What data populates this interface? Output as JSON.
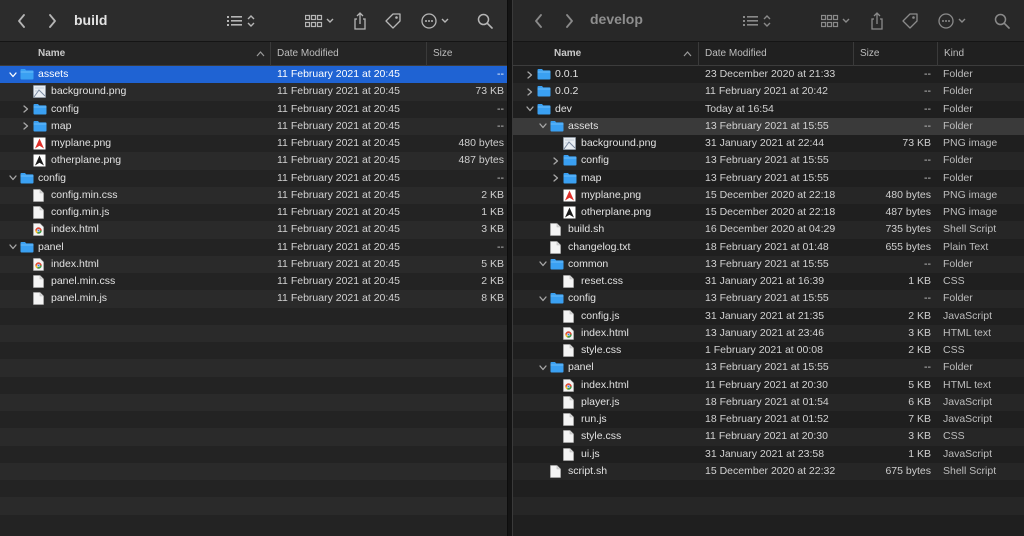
{
  "left": {
    "title": "build",
    "columns": {
      "name": "Name",
      "date": "Date Modified",
      "size": "Size"
    },
    "rows": [
      {
        "depth": 0,
        "disc": "open",
        "icon": "folder",
        "name": "assets",
        "date": "11 February 2021 at 20:45",
        "size": "--",
        "selected": true
      },
      {
        "depth": 1,
        "disc": "",
        "icon": "image",
        "name": "background.png",
        "date": "11 February 2021 at 20:45",
        "size": "73 KB"
      },
      {
        "depth": 1,
        "disc": "closed",
        "icon": "folder",
        "name": "config",
        "date": "11 February 2021 at 20:45",
        "size": "--"
      },
      {
        "depth": 1,
        "disc": "closed",
        "icon": "folder",
        "name": "map",
        "date": "11 February 2021 at 20:45",
        "size": "--"
      },
      {
        "depth": 1,
        "disc": "",
        "icon": "plane-red",
        "name": "myplane.png",
        "date": "11 February 2021 at 20:45",
        "size": "480 bytes"
      },
      {
        "depth": 1,
        "disc": "",
        "icon": "plane-dark",
        "name": "otherplane.png",
        "date": "11 February 2021 at 20:45",
        "size": "487 bytes"
      },
      {
        "depth": 0,
        "disc": "open",
        "icon": "folder",
        "name": "config",
        "date": "11 February 2021 at 20:45",
        "size": "--"
      },
      {
        "depth": 1,
        "disc": "",
        "icon": "doc",
        "name": "config.min.css",
        "date": "11 February 2021 at 20:45",
        "size": "2 KB"
      },
      {
        "depth": 1,
        "disc": "",
        "icon": "doc",
        "name": "config.min.js",
        "date": "11 February 2021 at 20:45",
        "size": "1 KB"
      },
      {
        "depth": 1,
        "disc": "",
        "icon": "html",
        "name": "index.html",
        "date": "11 February 2021 at 20:45",
        "size": "3 KB"
      },
      {
        "depth": 0,
        "disc": "open",
        "icon": "folder",
        "name": "panel",
        "date": "11 February 2021 at 20:45",
        "size": "--"
      },
      {
        "depth": 1,
        "disc": "",
        "icon": "html",
        "name": "index.html",
        "date": "11 February 2021 at 20:45",
        "size": "5 KB"
      },
      {
        "depth": 1,
        "disc": "",
        "icon": "doc",
        "name": "panel.min.css",
        "date": "11 February 2021 at 20:45",
        "size": "2 KB"
      },
      {
        "depth": 1,
        "disc": "",
        "icon": "doc",
        "name": "panel.min.js",
        "date": "11 February 2021 at 20:45",
        "size": "8 KB"
      }
    ],
    "empty_rows": 13
  },
  "right": {
    "title": "develop",
    "columns": {
      "name": "Name",
      "date": "Date Modified",
      "size": "Size",
      "kind": "Kind"
    },
    "rows": [
      {
        "depth": 0,
        "disc": "closed",
        "icon": "folder",
        "name": "0.0.1",
        "date": "23 December 2020 at 21:33",
        "size": "--",
        "kind": "Folder"
      },
      {
        "depth": 0,
        "disc": "closed",
        "icon": "folder",
        "name": "0.0.2",
        "date": "11 February 2021 at 20:42",
        "size": "--",
        "kind": "Folder"
      },
      {
        "depth": 0,
        "disc": "open",
        "icon": "folder",
        "name": "dev",
        "date": "Today at 16:54",
        "size": "--",
        "kind": "Folder"
      },
      {
        "depth": 1,
        "disc": "open",
        "icon": "folder",
        "name": "assets",
        "date": "13 February 2021 at 15:55",
        "size": "--",
        "kind": "Folder",
        "focus": true
      },
      {
        "depth": 2,
        "disc": "",
        "icon": "image",
        "name": "background.png",
        "date": "31 January 2021 at 22:44",
        "size": "73 KB",
        "kind": "PNG image"
      },
      {
        "depth": 2,
        "disc": "closed",
        "icon": "folder",
        "name": "config",
        "date": "13 February 2021 at 15:55",
        "size": "--",
        "kind": "Folder"
      },
      {
        "depth": 2,
        "disc": "closed",
        "icon": "folder",
        "name": "map",
        "date": "13 February 2021 at 15:55",
        "size": "--",
        "kind": "Folder"
      },
      {
        "depth": 2,
        "disc": "",
        "icon": "plane-red",
        "name": "myplane.png",
        "date": "15 December 2020 at 22:18",
        "size": "480 bytes",
        "kind": "PNG image"
      },
      {
        "depth": 2,
        "disc": "",
        "icon": "plane-dark",
        "name": "otherplane.png",
        "date": "15 December 2020 at 22:18",
        "size": "487 bytes",
        "kind": "PNG image"
      },
      {
        "depth": 1,
        "disc": "",
        "icon": "doc",
        "name": "build.sh",
        "date": "16 December 2020 at 04:29",
        "size": "735 bytes",
        "kind": "Shell Script"
      },
      {
        "depth": 1,
        "disc": "",
        "icon": "doc",
        "name": "changelog.txt",
        "date": "18 February 2021 at 01:48",
        "size": "655 bytes",
        "kind": "Plain Text"
      },
      {
        "depth": 1,
        "disc": "open",
        "icon": "folder",
        "name": "common",
        "date": "13 February 2021 at 15:55",
        "size": "--",
        "kind": "Folder"
      },
      {
        "depth": 2,
        "disc": "",
        "icon": "doc",
        "name": "reset.css",
        "date": "31 January 2021 at 16:39",
        "size": "1 KB",
        "kind": "CSS"
      },
      {
        "depth": 1,
        "disc": "open",
        "icon": "folder",
        "name": "config",
        "date": "13 February 2021 at 15:55",
        "size": "--",
        "kind": "Folder"
      },
      {
        "depth": 2,
        "disc": "",
        "icon": "doc",
        "name": "config.js",
        "date": "31 January 2021 at 21:35",
        "size": "2 KB",
        "kind": "JavaScript"
      },
      {
        "depth": 2,
        "disc": "",
        "icon": "html",
        "name": "index.html",
        "date": "13 January 2021 at 23:46",
        "size": "3 KB",
        "kind": "HTML text"
      },
      {
        "depth": 2,
        "disc": "",
        "icon": "doc",
        "name": "style.css",
        "date": "1 February 2021 at 00:08",
        "size": "2 KB",
        "kind": "CSS"
      },
      {
        "depth": 1,
        "disc": "open",
        "icon": "folder",
        "name": "panel",
        "date": "13 February 2021 at 15:55",
        "size": "--",
        "kind": "Folder"
      },
      {
        "depth": 2,
        "disc": "",
        "icon": "html",
        "name": "index.html",
        "date": "11 February 2021 at 20:30",
        "size": "5 KB",
        "kind": "HTML text"
      },
      {
        "depth": 2,
        "disc": "",
        "icon": "doc",
        "name": "player.js",
        "date": "18 February 2021 at 01:54",
        "size": "6 KB",
        "kind": "JavaScript"
      },
      {
        "depth": 2,
        "disc": "",
        "icon": "doc",
        "name": "run.js",
        "date": "18 February 2021 at 01:52",
        "size": "7 KB",
        "kind": "JavaScript"
      },
      {
        "depth": 2,
        "disc": "",
        "icon": "doc",
        "name": "style.css",
        "date": "11 February 2021 at 20:30",
        "size": "3 KB",
        "kind": "CSS"
      },
      {
        "depth": 2,
        "disc": "",
        "icon": "doc",
        "name": "ui.js",
        "date": "31 January 2021 at 23:58",
        "size": "1 KB",
        "kind": "JavaScript"
      },
      {
        "depth": 1,
        "disc": "",
        "icon": "doc",
        "name": "script.sh",
        "date": "15 December 2020 at 22:32",
        "size": "675 bytes",
        "kind": "Shell Script"
      }
    ],
    "empty_rows": 3
  },
  "colors": {
    "selection": "#1f63d3",
    "folder": "#3aa0f2"
  }
}
